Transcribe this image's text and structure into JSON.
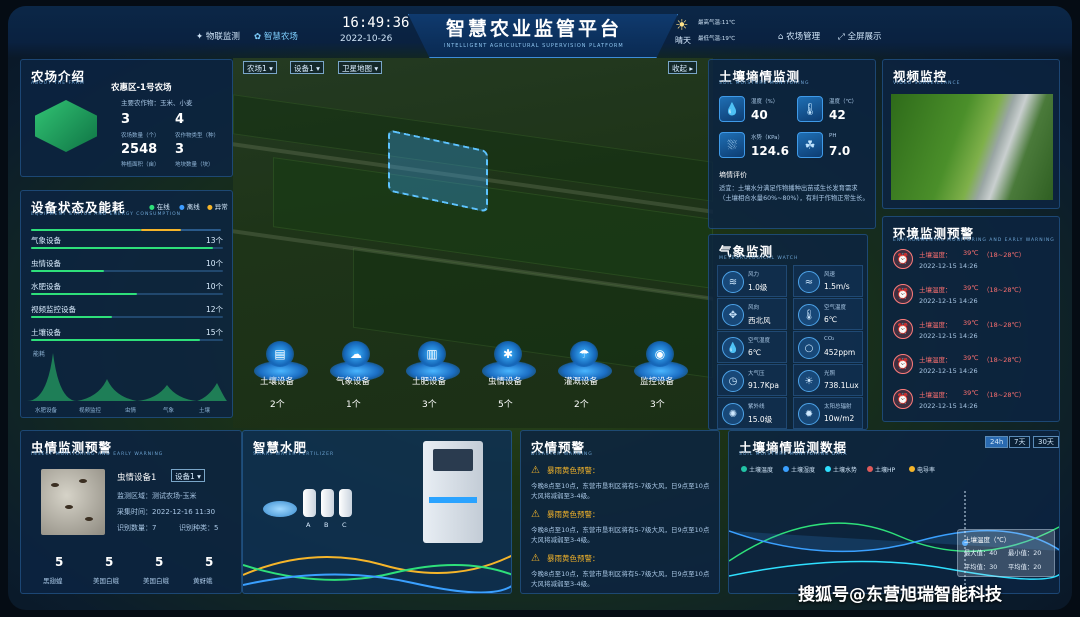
{
  "header": {
    "time": "16:49:36",
    "date": "2022-10-26",
    "title": "智慧农业监管平台",
    "subtitle": "INTELLIGENT AGRICULTURAL SUPERVISION PLATFORM",
    "nav_left": [
      "物联监测",
      "智慧农场"
    ],
    "nav_right": [
      "农场管理",
      "全屏展示"
    ],
    "weather": {
      "label": "晴天",
      "max_temp": "最高气温:11℃",
      "min_temp": "最低气温:19℃"
    }
  },
  "farm_intro": {
    "title": "农场介绍",
    "subtitle": "ABOUT THE FARM",
    "name": "农惠区-1号农场",
    "crops": "主要农作物：玉米、小麦",
    "stats": [
      {
        "value": "3",
        "label": "农场数量（个）"
      },
      {
        "value": "4",
        "label": "农作物类型（种）"
      },
      {
        "value": "2548",
        "label": "种植面积（亩）"
      },
      {
        "value": "3",
        "label": "地块数量（块）"
      }
    ]
  },
  "device_status": {
    "title": "设备状态及能耗",
    "subtitle": "EQUIPMENT STATUS AND ENERGY CONSUMPTION",
    "legend": [
      "在线",
      "离线",
      "异常"
    ],
    "items": [
      {
        "name": "气象设备",
        "count": "13个",
        "progress": 0.95
      },
      {
        "name": "虫情设备",
        "count": "10个",
        "progress": 0.38
      },
      {
        "name": "水肥设备",
        "count": "10个",
        "progress": 0.55
      },
      {
        "name": "视频监控设备",
        "count": "12个",
        "progress": 0.42
      },
      {
        "name": "土壤设备",
        "count": "15个",
        "progress": 0.88
      }
    ],
    "energy_label": "能耗",
    "energy_categories": [
      "水肥设备",
      "视频监控",
      "虫情",
      "气象",
      "土壤"
    ]
  },
  "pest_monitor": {
    "title": "虫情监测预警",
    "subtitle": "INSECT MONITORING AND EARLY WARNING",
    "device": "虫情设备1",
    "device_select": "设备1",
    "area": "监测区域：测试农场-玉米",
    "time": "采集时间：2022-12-16 11:30",
    "count": "识别数量：7",
    "species": "识别种类：5",
    "pests": [
      {
        "value": "5",
        "label": "黑翅蝗"
      },
      {
        "value": "5",
        "label": "美国白蛾"
      },
      {
        "value": "5",
        "label": "美国白蛾"
      },
      {
        "value": "5",
        "label": "黄蚜蛾"
      }
    ]
  },
  "map_controls": {
    "select_farm": "农场1",
    "select_device": "设备1",
    "select_map": "卫星地图",
    "collapse": "收起"
  },
  "map_devices": [
    {
      "label": "土壤设备",
      "count": "2个",
      "icon": "soil-icon"
    },
    {
      "label": "气象设备",
      "count": "1个",
      "icon": "weather-icon"
    },
    {
      "label": "土肥设备",
      "count": "3个",
      "icon": "fertilizer-icon"
    },
    {
      "label": "虫情设备",
      "count": "5个",
      "icon": "insect-icon"
    },
    {
      "label": "灌溉设备",
      "count": "2个",
      "icon": "irrigation-icon"
    },
    {
      "label": "监控设备",
      "count": "3个",
      "icon": "camera-icon"
    }
  ],
  "fertilizer": {
    "title": "智慧水肥",
    "subtitle": "SMART WATER FERTILIZER",
    "tanks": [
      "A",
      "B",
      "C"
    ]
  },
  "disaster": {
    "title": "灾情预警",
    "subtitle": "DISASTER WARNING",
    "alerts": [
      {
        "level": "暴雨黄色预警：",
        "text": "今晚8点至10点，东营市垦利区将有5-7级大风，日9点至10点大风将减弱至3-4级。"
      },
      {
        "level": "暴雨黄色预警：",
        "text": "今晚8点至10点，东营市垦利区将有5-7级大风，日9点至10点大风将减弱至3-4级。"
      },
      {
        "level": "暴雨黄色预警：",
        "text": "今晚8点至10点，东营市垦利区将有5-7级大风，日9点至10点大风将减弱至3-4级。"
      }
    ]
  },
  "soil": {
    "title": "土壤墒情监测",
    "subtitle": "SOIL MOISTURE MONITORING",
    "metrics": [
      {
        "label": "湿度（%）",
        "value": "40"
      },
      {
        "label": "温度（℃）",
        "value": "42"
      },
      {
        "label": "水势（KPa）",
        "value": "124.6"
      },
      {
        "label": "PH",
        "value": "7.0"
      }
    ],
    "evaluation_title": "墒情评价",
    "evaluation_text": "适宜：土壤水分满足作物播种出苗或生长发育需求（土壤相合水量60%~80%），有利于作物正常生长。"
  },
  "video": {
    "title": "视频监控",
    "subtitle": "VIDEO SURVEILLANCE"
  },
  "weather_monitor": {
    "title": "气象监测",
    "subtitle": "METEOROLOGICAL WATCH",
    "items": [
      {
        "label": "风力",
        "value": "1.0级",
        "icon": "wind-icon"
      },
      {
        "label": "风速",
        "value": "1.5m/s",
        "icon": "wind-speed-icon"
      },
      {
        "label": "风向",
        "value": "西北风",
        "icon": "compass-icon"
      },
      {
        "label": "空气温度",
        "value": "6℃",
        "icon": "thermometer-icon"
      },
      {
        "label": "空气湿度",
        "value": "6℃",
        "icon": "humidity-icon"
      },
      {
        "label": "CO₂",
        "value": "452ppm",
        "icon": "co2-icon"
      },
      {
        "label": "大气压",
        "value": "91.7Kpa",
        "icon": "pressure-icon"
      },
      {
        "label": "光照",
        "value": "738.1Lux",
        "icon": "sun-icon"
      },
      {
        "label": "紫外线",
        "value": "15.0级",
        "icon": "uv-icon"
      },
      {
        "label": "太阳总辐射",
        "value": "10w/m2",
        "icon": "radiation-icon"
      }
    ]
  },
  "env_alert": {
    "title": "环境监测预警",
    "subtitle": "ENVIRONMENTAL MONITORING AND EARLY WARNING",
    "items": [
      {
        "label": "土壤温度：",
        "value": "39℃",
        "range": "（18~28℃）",
        "date": "2022-12-15 14:26"
      },
      {
        "label": "土壤温度：",
        "value": "39℃",
        "range": "（18~28℃）",
        "date": "2022-12-15 14:26"
      },
      {
        "label": "土壤温度：",
        "value": "39℃",
        "range": "（18~28℃）",
        "date": "2022-12-15 14:26"
      },
      {
        "label": "土壤温度：",
        "value": "39℃",
        "range": "（18~28℃）",
        "date": "2022-12-15 14:26"
      },
      {
        "label": "土壤温度：",
        "value": "39℃",
        "range": "（18~28℃）",
        "date": "2022-12-15 14:26"
      }
    ]
  },
  "soil_data": {
    "title": "土壤墒情监测数据",
    "subtitle": "SOIL MOISTURE MONITORING DATA",
    "tabs": [
      "24h",
      "7天",
      "30天"
    ],
    "legend": [
      {
        "name": "土壤温度",
        "color": "#22c3a6"
      },
      {
        "name": "土壤湿度",
        "color": "#3aa0ff"
      },
      {
        "name": "土壤水势",
        "color": "#2fe0ff"
      },
      {
        "name": "土壤HP",
        "color": "#e05a5a"
      },
      {
        "name": "电导率",
        "color": "#f5b52a"
      }
    ],
    "tooltip": {
      "title": "土壤温度（℃）",
      "max": "最大值：40",
      "min": "最小值：20",
      "avg": "平均值：30",
      "avg2": "平均值：20"
    }
  },
  "watermark": "搜狐号@东营旭瑞智能科技",
  "colors": {
    "accent": "#3d9cff",
    "green": "#2ee07a",
    "warn": "#f5b52a",
    "alert": "#ff7070"
  }
}
